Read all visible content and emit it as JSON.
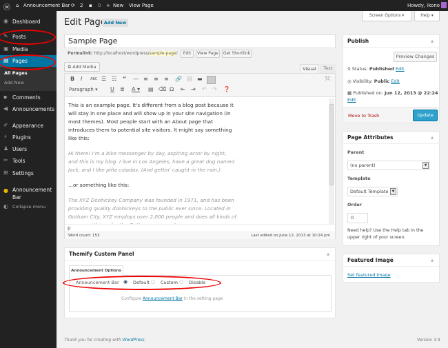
{
  "adminbar": {
    "site": "Announcement Bar",
    "updates": "2",
    "comments": "0",
    "new": "New",
    "view": "View Page",
    "howdy": "Howdy, ikono"
  },
  "sidebar": {
    "items": [
      {
        "label": "Dashboard",
        "icon": "dashboard-icon"
      },
      {
        "label": "Posts",
        "icon": "pin-icon"
      },
      {
        "label": "Media",
        "icon": "media-icon"
      },
      {
        "label": "Pages",
        "icon": "pages-icon",
        "active": true
      },
      {
        "label": "Comments",
        "icon": "comment-icon"
      },
      {
        "label": "Announcements",
        "icon": "megaphone-icon"
      },
      {
        "label": "Appearance",
        "icon": "brush-icon"
      },
      {
        "label": "Plugins",
        "icon": "plugin-icon"
      },
      {
        "label": "Users",
        "icon": "users-icon"
      },
      {
        "label": "Tools",
        "icon": "wrench-icon"
      },
      {
        "label": "Settings",
        "icon": "settings-icon"
      },
      {
        "label": "Announcement Bar",
        "icon": "announcement-icon"
      },
      {
        "label": "Collapse menu",
        "icon": "collapse-icon"
      }
    ],
    "submenu": [
      "All Pages",
      "Add New"
    ],
    "accent": "#0074a2"
  },
  "header": {
    "title": "Edit Page",
    "add_new": "Add New",
    "screen_options": "Screen Options",
    "help": "Help"
  },
  "editor": {
    "title": "Sample Page",
    "permalink_label": "Permalink:",
    "permalink_base": "http://localhost/wordpress/",
    "permalink_slug": "sample-page",
    "permalink_end": "/",
    "edit": "Edit",
    "view_page": "View Page",
    "shortlink": "Get Shortlink",
    "add_media": "Add Media",
    "tab_visual": "Visual",
    "tab_text": "Text",
    "format": "Paragraph",
    "paragraphs": [
      "This is an example page. It's different from a blog post because it will stay in one place and will show up in your site navigation (in most themes). Most people start with an About page that introduces them to potential site visitors. It might say something like this:",
      "Hi there! I'm a bike messenger by day, aspiring actor by night, and this is my blog. I live in Los Angeles, have a great dog named Jack, and I like piña coladas. (And gettin' caught in the rain.)",
      "...or something like this:",
      "The XYZ Doohickey Company was founded in 1971, and has been providing quality doohickeys to the public ever since. Located in Gotham City, XYZ employs over 2,000 people and does all kinds of awesome things for the Gotham community."
    ],
    "path": "p",
    "word_count": "Word count: 153",
    "last_edited": "Last edited on June 12, 2013 at 10:24 pm"
  },
  "themify": {
    "title": "Themify Custom Panel",
    "tab": "Announcement Options",
    "field": "Announcement Bar",
    "options": [
      "Default",
      "Custom",
      "Disable"
    ],
    "selected": "Default",
    "note_pre": "Configure ",
    "note_link": "Announcement Bar",
    "note_post": " in the setting page"
  },
  "publish": {
    "title": "Publish",
    "preview": "Preview Changes",
    "status_label": "Status:",
    "status": "Published",
    "visibility_label": "Visibility:",
    "visibility": "Public",
    "published_label": "Published on:",
    "published": "Jun 12, 2013 @ 22:24",
    "edit": "Edit",
    "trash": "Move to Trash",
    "update": "Update"
  },
  "attributes": {
    "title": "Page Attributes",
    "parent_label": "Parent",
    "parent": "(no parent)",
    "template_label": "Template",
    "template": "Default Template",
    "order_label": "Order",
    "order": "0",
    "help": "Need help? Use the Help tab in the upper right of your screen."
  },
  "featured": {
    "title": "Featured Image",
    "link": "Set featured image"
  },
  "footer": {
    "thanks": "Thank you for creating with ",
    "wp": "WordPress",
    "period": ".",
    "version": "Version 3.9"
  }
}
